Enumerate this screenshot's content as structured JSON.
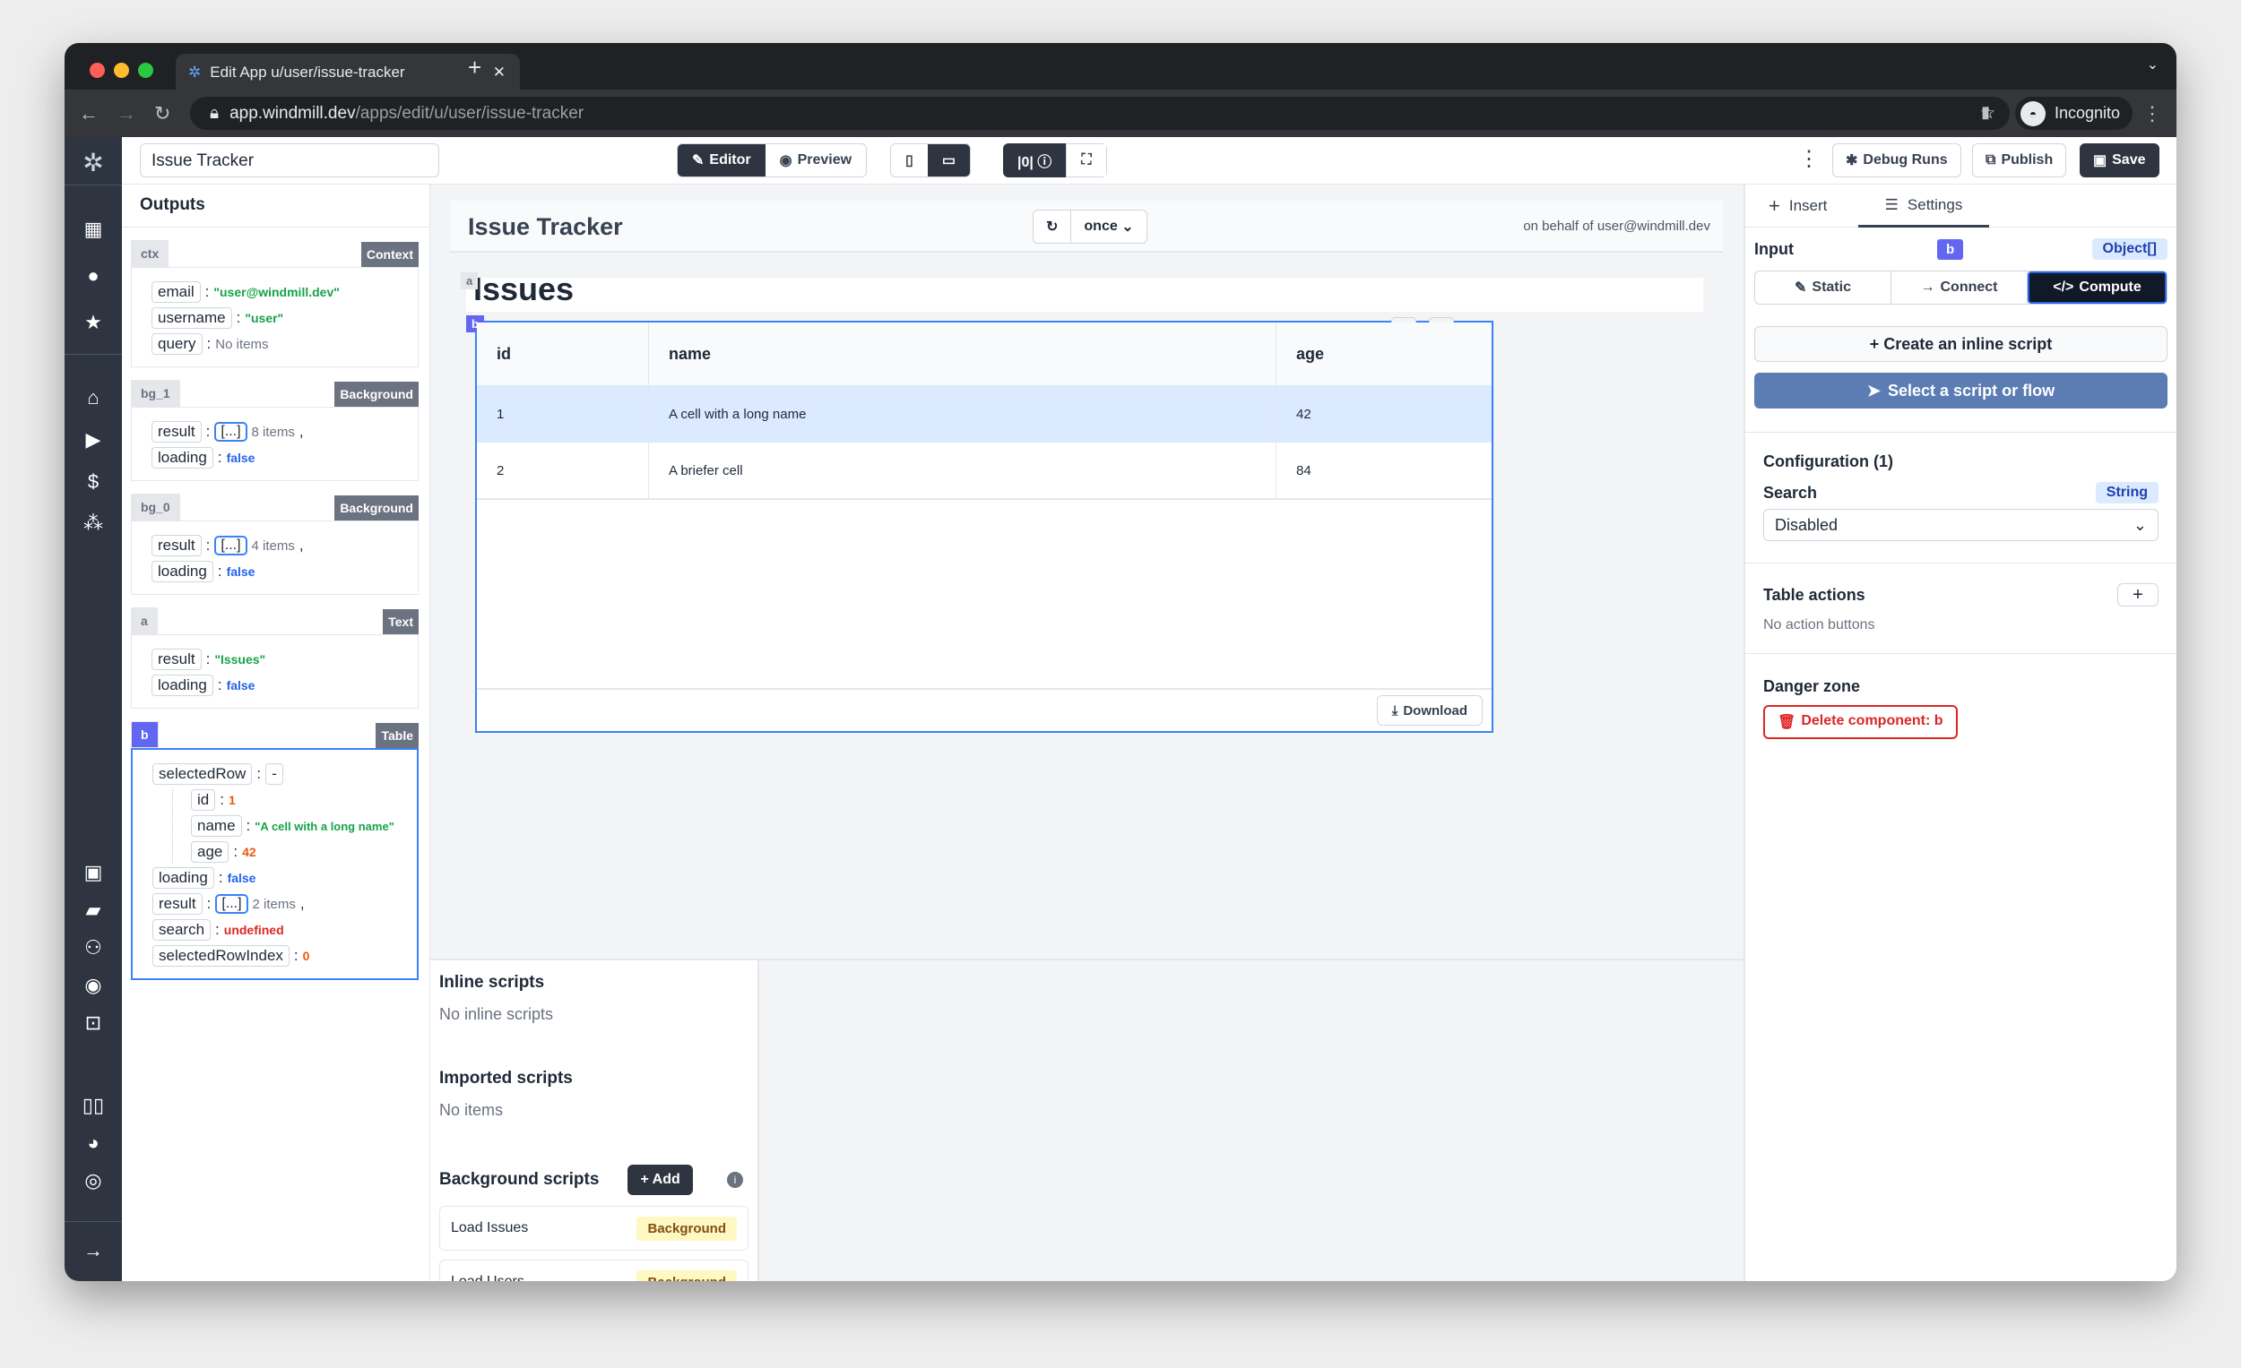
{
  "browser": {
    "tab_title": "Edit App u/user/issue-tracker",
    "url_host": "app.windmill.dev",
    "url_path": "/apps/edit/u/user/issue-tracker",
    "profile": "Incognito"
  },
  "header": {
    "app_name": "Issue Tracker",
    "editor": "Editor",
    "preview": "Preview",
    "debug_runs": "Debug Runs",
    "publish": "Publish",
    "save": "Save"
  },
  "outputs": {
    "title": "Outputs",
    "cards": [
      {
        "id": "ctx",
        "type": "Context",
        "rows": [
          {
            "k": "email",
            "v": "\"user@windmill.dev\""
          },
          {
            "k": "username",
            "v": "\"user\""
          },
          {
            "k": "query",
            "v": "No items"
          }
        ]
      },
      {
        "id": "bg_1",
        "type": "Background",
        "rows": [
          {
            "k": "result",
            "arr": "[...]",
            "v": "8 items"
          },
          {
            "k": "loading",
            "v": "false"
          }
        ]
      },
      {
        "id": "bg_0",
        "type": "Background",
        "rows": [
          {
            "k": "result",
            "arr": "[...]",
            "v": "4 items"
          },
          {
            "k": "loading",
            "v": "false"
          }
        ]
      },
      {
        "id": "a",
        "type": "Text",
        "rows": [
          {
            "k": "result",
            "v": "\"Issues\""
          },
          {
            "k": "loading",
            "v": "false"
          }
        ]
      },
      {
        "id": "b",
        "type": "Table",
        "rows": [
          {
            "k": "selectedRow",
            "v": "-"
          },
          {
            "k": "id",
            "v": "1"
          },
          {
            "k": "name",
            "v": "\"A cell with a long name\""
          },
          {
            "k": "age",
            "v": "42"
          },
          {
            "k": "loading",
            "v": "false"
          },
          {
            "k": "result",
            "arr": "[...]",
            "v": "2 items"
          },
          {
            "k": "search",
            "v": "undefined"
          },
          {
            "k": "selectedRowIndex",
            "v": "0"
          }
        ]
      }
    ]
  },
  "canvas": {
    "title": "Issue Tracker",
    "refresh": "once",
    "behalf": "on behalf of user@windmill.dev",
    "text_id": "a",
    "text": "Issues",
    "table_id": "b",
    "columns": [
      "id",
      "name",
      "age"
    ],
    "rows": [
      [
        "1",
        "A cell with a long name",
        "42"
      ],
      [
        "2",
        "A briefer cell",
        "84"
      ]
    ],
    "download": "Download"
  },
  "scripts": {
    "inline_title": "Inline scripts",
    "inline_empty": "No inline scripts",
    "imported_title": "Imported scripts",
    "imported_empty": "No items",
    "bg_title": "Background scripts",
    "add": "+ Add",
    "items": [
      {
        "name": "Load Issues",
        "badge": "Background"
      },
      {
        "name": "Load Users",
        "badge": "Background"
      }
    ]
  },
  "settings": {
    "tab_insert": "Insert",
    "tab_settings": "Settings",
    "input_label": "Input",
    "component_id": "b",
    "input_type": "Object[]",
    "modes": [
      "Static",
      "Connect",
      "Compute"
    ],
    "create_inline": "+ Create an inline script",
    "select_script": "Select a script or flow",
    "config_title": "Configuration (1)",
    "search_label": "Search",
    "search_type": "String",
    "search_value": "Disabled",
    "actions_title": "Table actions",
    "actions_empty": "No action buttons",
    "danger_title": "Danger zone",
    "delete": "Delete component: b"
  }
}
